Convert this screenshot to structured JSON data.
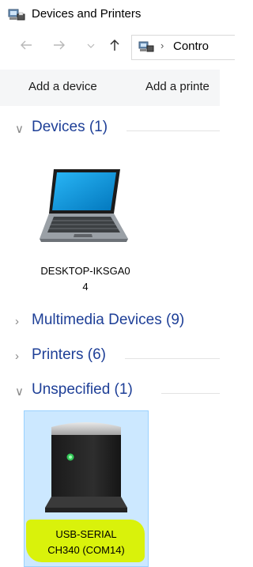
{
  "window": {
    "title": "Devices and Printers",
    "icon": "devices-and-printers-icon"
  },
  "nav": {
    "back_icon": "arrow-left-icon",
    "forward_icon": "arrow-right-icon",
    "recent_icon": "chevron-down-icon",
    "up_icon": "arrow-up-icon",
    "address_separator": "›",
    "address_text": "Contro"
  },
  "commands": {
    "add_device": "Add a device",
    "add_printer": "Add a printe"
  },
  "groups": {
    "devices": {
      "label": "Devices (1)",
      "expanded": true
    },
    "multimedia": {
      "label": "Multimedia Devices (9)",
      "expanded": false
    },
    "printers": {
      "label": "Printers (6)",
      "expanded": false
    },
    "unspecified": {
      "label": "Unspecified (1)",
      "expanded": true
    }
  },
  "chevrons": {
    "expanded": "∨",
    "collapsed": "›"
  },
  "devices": [
    {
      "name_line1": "DESKTOP-IKSGA0",
      "name_line2": "4",
      "icon": "laptop-icon"
    }
  ],
  "unspecified_items": [
    {
      "name_line1": "USB-SERIAL",
      "name_line2": "CH340 (COM14)",
      "icon": "usb-device-icon",
      "selected": true,
      "highlight_color": "#d9f20b"
    }
  ],
  "colors": {
    "group_label": "#1e3f97",
    "selection_bg": "#cce8ff",
    "selection_border": "#99d1ff",
    "command_bar_bg": "#f5f6f7"
  }
}
